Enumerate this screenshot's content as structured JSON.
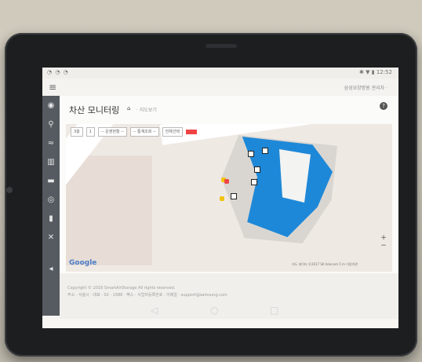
{
  "statusbar": {
    "icons_left": "◔ ◔ ◔",
    "time": "12:52",
    "icons_right": "✱ ▼ ▮"
  },
  "header": {
    "user": "삼성요양병원 관리자 ·"
  },
  "page": {
    "title": "차산 모니터링",
    "crumb_home": "⌂",
    "crumb": "· 지도보기"
  },
  "filters": [
    "3층",
    "1",
    "-- 운영현황 --",
    "-- 통계조회 --",
    "전체선택"
  ],
  "map": {
    "brand": "Google",
    "attribution": "지도 데이터 ©2017 SK telecom   5 m   이용약관"
  },
  "footer": {
    "line1": "Copyright © 2016 SmartAirStorage All rights reserved.",
    "line2": "주소 · 서울시 · 대표 · 02 · 1588 · 팩스 · 사업자등록번호 · 이메일 · support@samsung.com"
  },
  "navbar": {
    "back": "◁",
    "home": "○",
    "recent": "□"
  },
  "colors": {
    "building": "#1e88d8",
    "rail": "#555b60",
    "accent": "#e44"
  }
}
